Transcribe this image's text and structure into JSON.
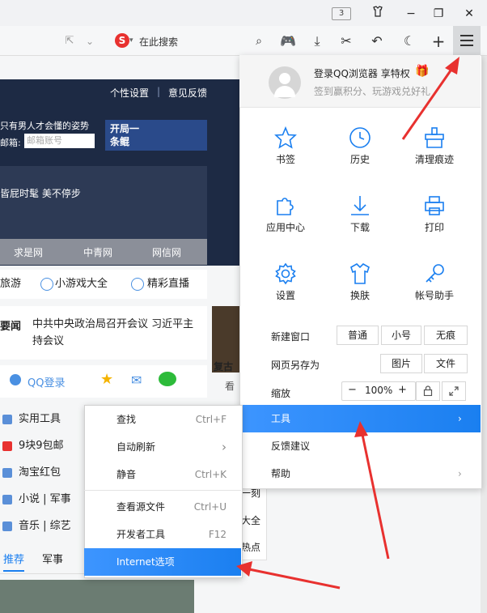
{
  "titlebar": {
    "tab_count": "3"
  },
  "toolbar": {
    "search_placeholder": "在此搜索"
  },
  "page": {
    "top_links": [
      "个性设置",
      "意见反馈"
    ],
    "banner_line1": "只有男人才会懂的姿势",
    "banner_line2": "邮箱:",
    "email_placeholder": "邮箱账号",
    "promo": "开局一条鲲",
    "banner_line3": "皆屁时髦 美不停步",
    "strip_links": [
      "求是网",
      "中青网",
      "网信网"
    ],
    "pills": [
      "旅游",
      "小游戏大全",
      "精彩直播"
    ],
    "news_label": "要闻",
    "news_text": "中共中央政治局召开会议 习近平主持会议",
    "qq_login": "QQ登录",
    "side_text": "复古",
    "side_text2": "看",
    "left_items": [
      "实用工具",
      "9块9包邮",
      "淘宝红包",
      "小说 | 军事",
      "音乐 | 综艺"
    ],
    "bottom_tabs": [
      "推荐",
      "军事"
    ],
    "right_small": [
      "一刻",
      "大全",
      "热点"
    ]
  },
  "menu": {
    "login_title": "登录QQ浏览器 享特权",
    "login_sub": "签到赢积分、玩游戏兑好礼",
    "grid": [
      {
        "label": "书签",
        "icon": "star-icon"
      },
      {
        "label": "历史",
        "icon": "clock-icon"
      },
      {
        "label": "清理痕迹",
        "icon": "broom-icon"
      },
      {
        "label": "应用中心",
        "icon": "puzzle-icon"
      },
      {
        "label": "下载",
        "icon": "download-icon"
      },
      {
        "label": "打印",
        "icon": "printer-icon"
      },
      {
        "label": "设置",
        "icon": "gear-icon"
      },
      {
        "label": "换肤",
        "icon": "shirt-icon"
      },
      {
        "label": "帐号助手",
        "icon": "key-icon"
      }
    ],
    "new_window": {
      "label": "新建窗口",
      "options": [
        "普通",
        "小号",
        "无痕"
      ]
    },
    "save_as": {
      "label": "网页另存为",
      "options": [
        "图片",
        "文件"
      ]
    },
    "zoom": {
      "label": "缩放",
      "minus": "−",
      "value": "100%",
      "plus": "+"
    },
    "items": [
      {
        "label": "工具",
        "has_arrow": true,
        "active": true
      },
      {
        "label": "反馈建议",
        "has_arrow": false
      },
      {
        "label": "帮助",
        "has_arrow": true
      }
    ],
    "active_color": "#1a7ff0"
  },
  "submenu": {
    "items": [
      {
        "label": "查找",
        "shortcut": "Ctrl+F"
      },
      {
        "label": "自动刷新",
        "shortcut": "›"
      },
      {
        "label": "静音",
        "shortcut": "Ctrl+K"
      },
      {
        "label": "查看源文件",
        "shortcut": "Ctrl+U"
      },
      {
        "label": "开发者工具",
        "shortcut": "F12"
      },
      {
        "label": "Internet选项",
        "shortcut": ""
      }
    ]
  }
}
